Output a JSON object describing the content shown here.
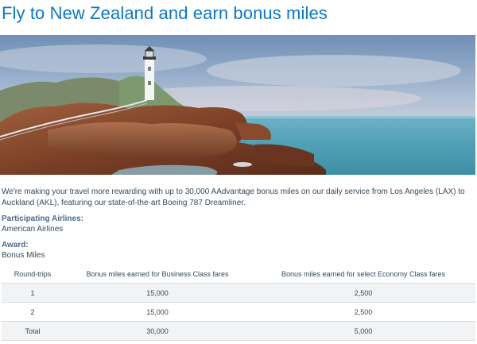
{
  "page": {
    "title": "Fly to New Zealand and earn bonus miles",
    "intro": "We're making your travel more rewarding with up to 30,000 AAdvantage bonus miles on our daily service from Los Angeles (LAX) to Auckland (AKL), featuring our state-of-the-art Boeing 787 Dreamliner."
  },
  "details": {
    "airlines_label": "Participating Airlines:",
    "airlines_value": "American Airlines",
    "award_label": "Award:",
    "award_value": "Bonus Miles"
  },
  "table": {
    "headers": [
      "Round-trips",
      "Bonus miles earned for Business Class fares",
      "Bonus miles earned for select Economy Class fares"
    ],
    "rows": [
      [
        "1",
        "15,000",
        "2,500"
      ],
      [
        "2",
        "15,000",
        "2,500"
      ],
      [
        "Total",
        "30,000",
        "5,000"
      ]
    ]
  },
  "colors": {
    "title": "#0a78c7",
    "label": "#4b6a86",
    "text": "#36495a",
    "row_shade": "#f1f3f5"
  }
}
